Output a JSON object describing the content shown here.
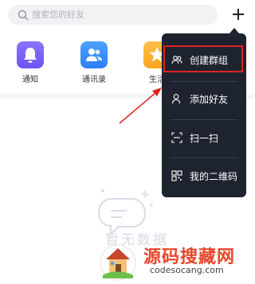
{
  "search": {
    "placeholder": "搜索您的好友"
  },
  "shortcuts": [
    {
      "label": "通知",
      "icon": "bell-icon",
      "color": "#7b63fb"
    },
    {
      "label": "通讯录",
      "icon": "contacts-icon",
      "color": "#3a8ffb"
    },
    {
      "label": "生活",
      "icon": "star-icon",
      "color": "#ffb02e"
    }
  ],
  "menu": {
    "background": "#1d2430",
    "items": [
      {
        "label": "创建群组",
        "icon": "group-icon"
      },
      {
        "label": "添加好友",
        "icon": "add-friend-icon"
      },
      {
        "label": "扫一扫",
        "icon": "scan-icon"
      },
      {
        "label": "我的二维码",
        "icon": "qr-code-icon"
      }
    ]
  },
  "annotation": {
    "highlight_color": "#e02020"
  },
  "empty_state": {
    "text": "暂无数据"
  },
  "watermark": {
    "text": "源码搜藏网",
    "url": "codesocang.com"
  }
}
